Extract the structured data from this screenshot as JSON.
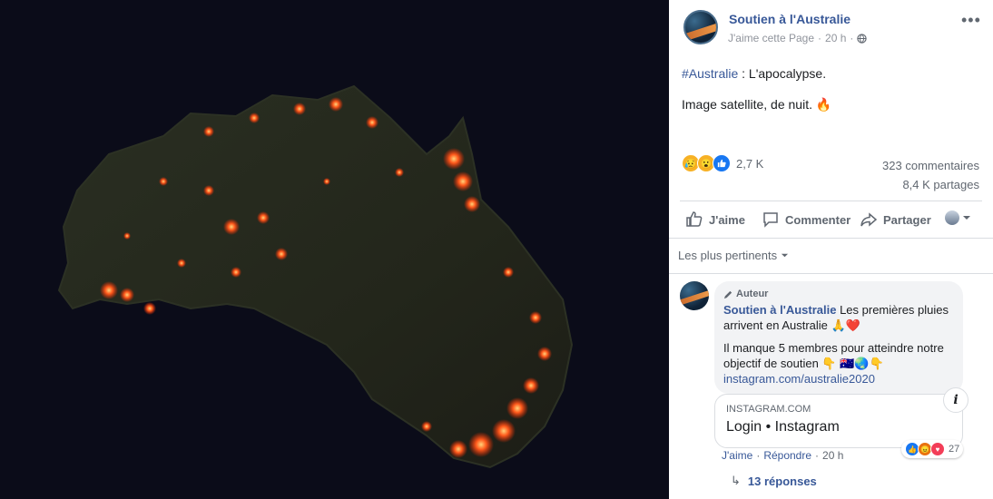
{
  "post": {
    "page_name": "Soutien à l'Australie",
    "like_page": "J'aime cette Page",
    "time": "20 h",
    "hashtag": "#Australie",
    "text_line1_rest": " : L'apocalypse.",
    "text_line2": "Image satellite, de nuit. 🔥",
    "reaction_count": "2,7 K",
    "comments_count": "323 commentaires",
    "shares_count": "8,4 K partages",
    "reaction_icons": [
      "sad-emoji",
      "wow-emoji",
      "like-thumb"
    ]
  },
  "actions": {
    "like": "J'aime",
    "comment": "Commenter",
    "share": "Partager"
  },
  "comments_filter": "Les plus pertinents",
  "comment": {
    "author_badge": "Auteur",
    "author": "Soutien à l'Australie",
    "text1": " Les premières pluies arrivent en Australie 🙏❤️",
    "text2": "Il manque 5 membres pour atteindre notre objectif de soutien 👇 🇦🇺🌏👇",
    "link": "instagram.com/australie2020",
    "card_domain": "INSTAGRAM.COM",
    "card_title": "Login • Instagram",
    "like": "J'aime",
    "reply": "Répondre",
    "time": "20 h",
    "reaction_count": "27",
    "replies": "13 réponses"
  },
  "colors": {
    "link": "#385898",
    "fire": "#ff4a1c",
    "night": "#0c0d1a"
  }
}
